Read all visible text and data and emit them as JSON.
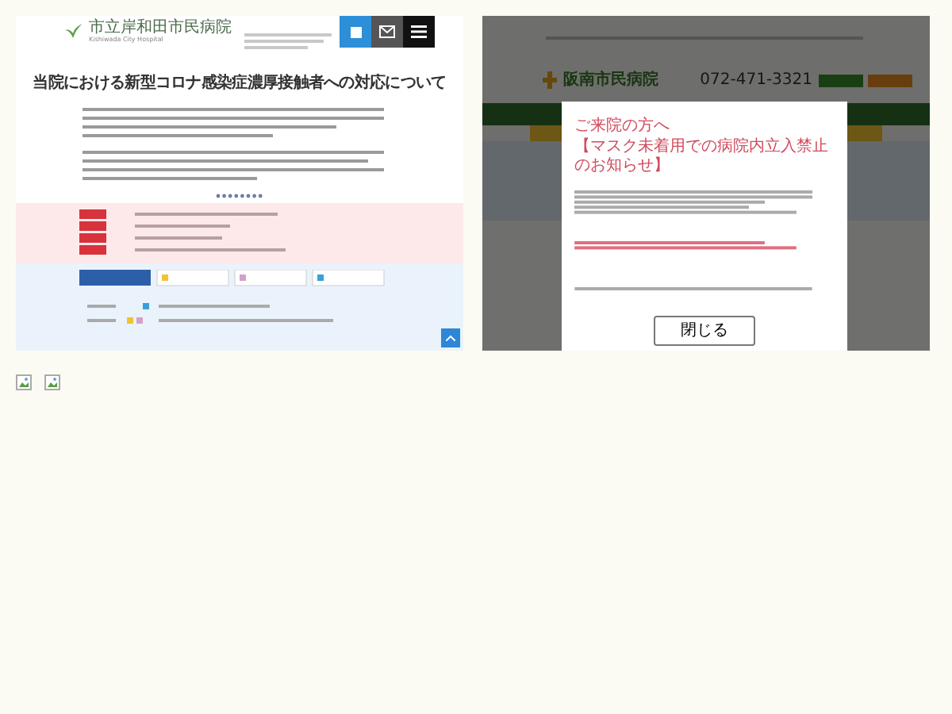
{
  "screenshots": [
    {
      "kind": "page",
      "logo": "市立岸和田市民病院",
      "logo_subtitle": "Kishiwada City Hospital",
      "heading": "当院における新型コロナ感染症濃厚接触者への対応について"
    },
    {
      "kind": "modal_page",
      "site_name": "阪南市民病院",
      "phone": "072-471-3321",
      "modal": {
        "title": "ご来院の方へ",
        "subtitle": "【マスク未着用での病院内立入禁止のお知らせ】",
        "close_button": "閉じる"
      }
    }
  ]
}
